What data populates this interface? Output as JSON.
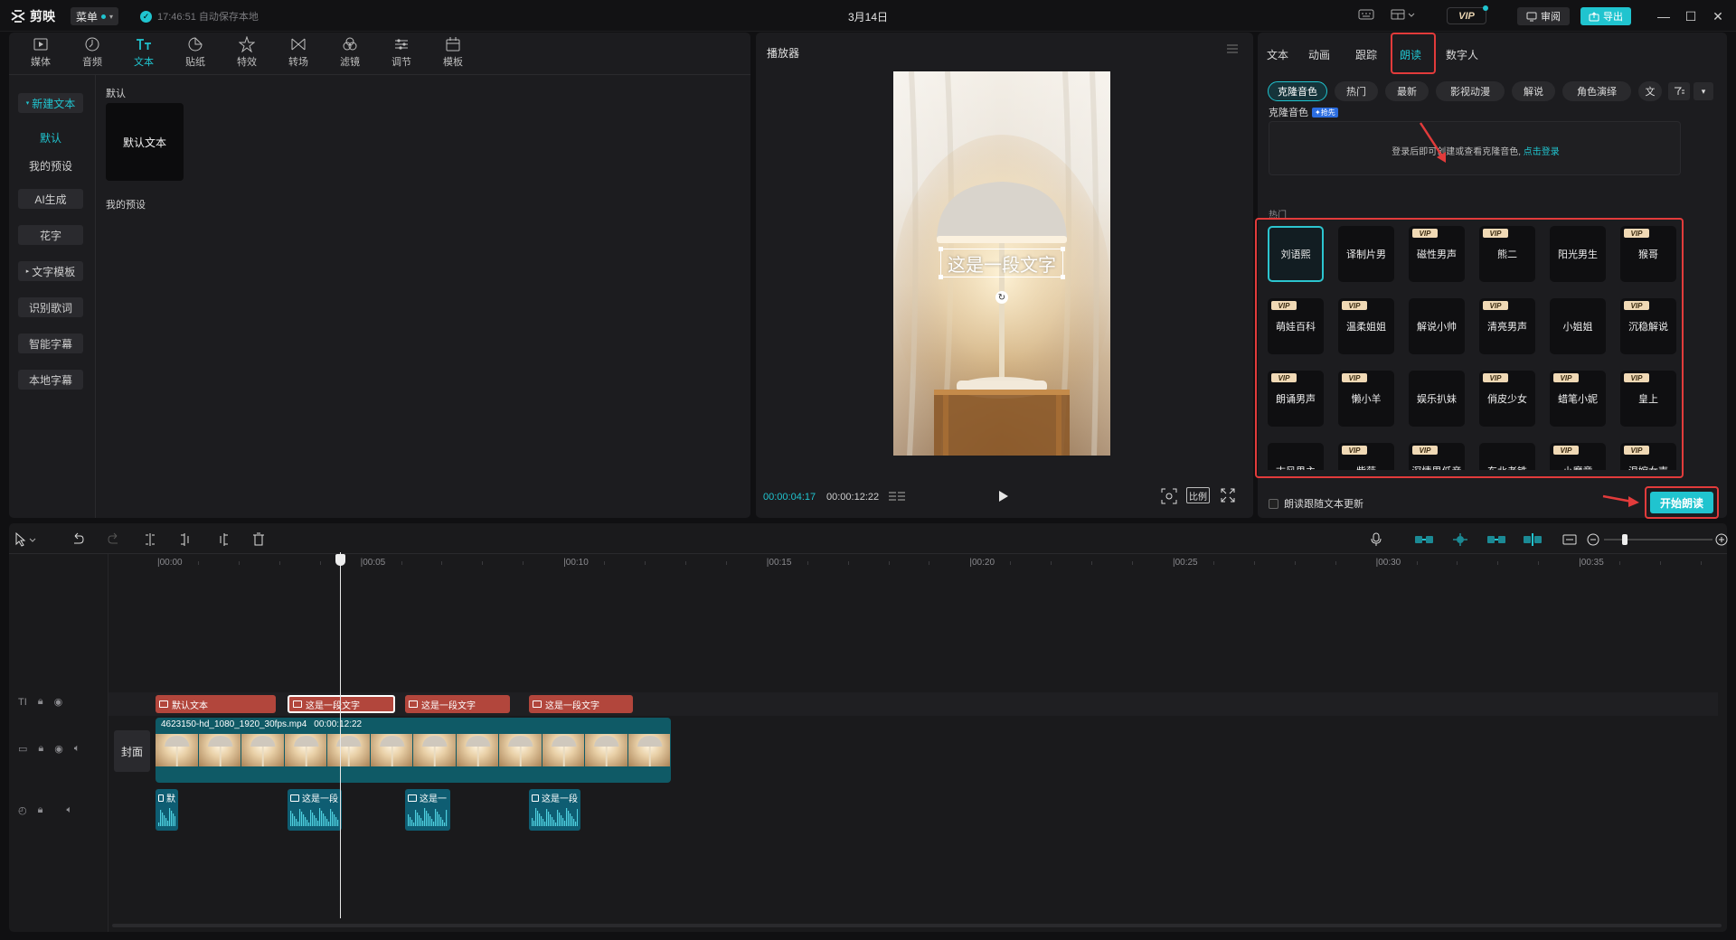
{
  "app": {
    "name": "剪映",
    "menu_label": "菜单",
    "save_status": "17:46:51 自动保存本地",
    "project_title": "3月14日",
    "vip_label": "VIP",
    "review_label": "审阅",
    "export_label": "导出"
  },
  "toolbar": {
    "tabs": [
      {
        "label": "媒体",
        "icon": "media-icon"
      },
      {
        "label": "音频",
        "icon": "audio-icon"
      },
      {
        "label": "文本",
        "icon": "text-icon"
      },
      {
        "label": "贴纸",
        "icon": "sticker-icon"
      },
      {
        "label": "特效",
        "icon": "effects-icon"
      },
      {
        "label": "转场",
        "icon": "transition-icon"
      },
      {
        "label": "滤镜",
        "icon": "filter-icon"
      },
      {
        "label": "调节",
        "icon": "adjust-icon"
      },
      {
        "label": "模板",
        "icon": "template-icon"
      }
    ],
    "active_tab": "文本"
  },
  "text_sidebar": {
    "items": [
      "新建文本",
      "默认",
      "我的预设",
      "AI生成",
      "花字",
      "文字模板",
      "识别歌词",
      "智能字幕",
      "本地字幕"
    ]
  },
  "text_content": {
    "default_section": "默认",
    "default_card": "默认文本",
    "preset_section": "我的预设"
  },
  "player": {
    "title": "播放器",
    "overlay_text": "这是一段文字",
    "current_time": "00:00:04:17",
    "total_time": "00:00:12:22",
    "ratio_label": "比例"
  },
  "right_panel": {
    "tabs": [
      "文本",
      "动画",
      "跟踪",
      "朗读",
      "数字人"
    ],
    "active_tab": "朗读",
    "chips": [
      "克隆音色",
      "热门",
      "最新",
      "影视动漫",
      "解说",
      "角色演绎",
      "文"
    ],
    "clone_label": "克隆音色",
    "clone_badge": "✦抢先",
    "clone_hint": "登录后即可创建或查看克隆音色,",
    "clone_link": "点击登录",
    "hot_label": "热门",
    "voices": [
      {
        "name": "刘语熙",
        "vip": false,
        "selected": true
      },
      {
        "name": "译制片男",
        "vip": false
      },
      {
        "name": "磁性男声",
        "vip": true
      },
      {
        "name": "熊二",
        "vip": true
      },
      {
        "name": "阳光男生",
        "vip": false
      },
      {
        "name": "猴哥",
        "vip": true
      },
      {
        "name": "萌娃百科",
        "vip": true
      },
      {
        "name": "温柔姐姐",
        "vip": true
      },
      {
        "name": "解说小帅",
        "vip": false
      },
      {
        "name": "清亮男声",
        "vip": true
      },
      {
        "name": "小姐姐",
        "vip": false
      },
      {
        "name": "沉稳解说",
        "vip": true
      },
      {
        "name": "朗诵男声",
        "vip": true
      },
      {
        "name": "懒小羊",
        "vip": true
      },
      {
        "name": "娱乐扒妹",
        "vip": false
      },
      {
        "name": "俏皮少女",
        "vip": true
      },
      {
        "name": "蜡笔小妮",
        "vip": true
      },
      {
        "name": "皇上",
        "vip": true
      },
      {
        "name": "古风男主",
        "vip": false
      },
      {
        "name": "紫薇",
        "vip": true
      },
      {
        "name": "深情男低音",
        "vip": true
      },
      {
        "name": "东北老铁",
        "vip": false
      },
      {
        "name": "小魔童",
        "vip": true
      },
      {
        "name": "温婉女声",
        "vip": true
      }
    ],
    "follow_text_label": "朗读跟随文本更新",
    "start_button": "开始朗读"
  },
  "timeline": {
    "ruler": [
      "|00:00",
      "|00:05",
      "|00:10",
      "|00:15",
      "|00:20",
      "|00:25",
      "|00:30",
      "|00:35"
    ],
    "cover_label": "封面",
    "text_clips": [
      "默认文本",
      "这是一段文字",
      "这是一段文字",
      "这是一段文字"
    ],
    "video_clip": {
      "name": "4623150-hd_1080_1920_30fps.mp4",
      "duration": "00:00:12:22"
    },
    "audio_clips": [
      "默",
      "这是一段",
      "这是一",
      "这是一段"
    ]
  },
  "colors": {
    "accent": "#20c4cf",
    "text_clip": "#b2463c",
    "audio_clip": "#0e5d72",
    "highlight": "#e23b3b"
  }
}
